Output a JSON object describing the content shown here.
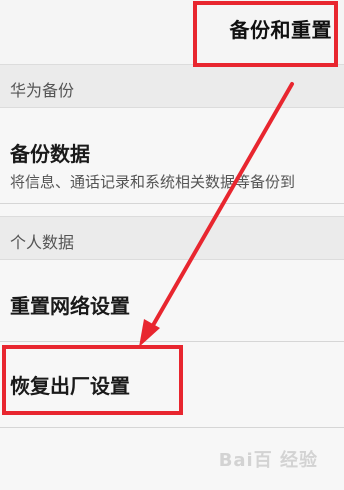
{
  "header": {
    "title": "备份和重置"
  },
  "sections": [
    {
      "label": "华为备份",
      "items": [
        {
          "title": "备份数据",
          "subtitle": "将信息、通话记录和系统相关数据等备份到"
        }
      ]
    },
    {
      "label": "个人数据",
      "items": [
        {
          "title": "重置网络设置"
        },
        {
          "title": "恢复出厂设置"
        }
      ]
    }
  ],
  "annotations": {
    "highlight_color": "#e8262f"
  },
  "watermark": {
    "text": "Bai百 经验"
  }
}
